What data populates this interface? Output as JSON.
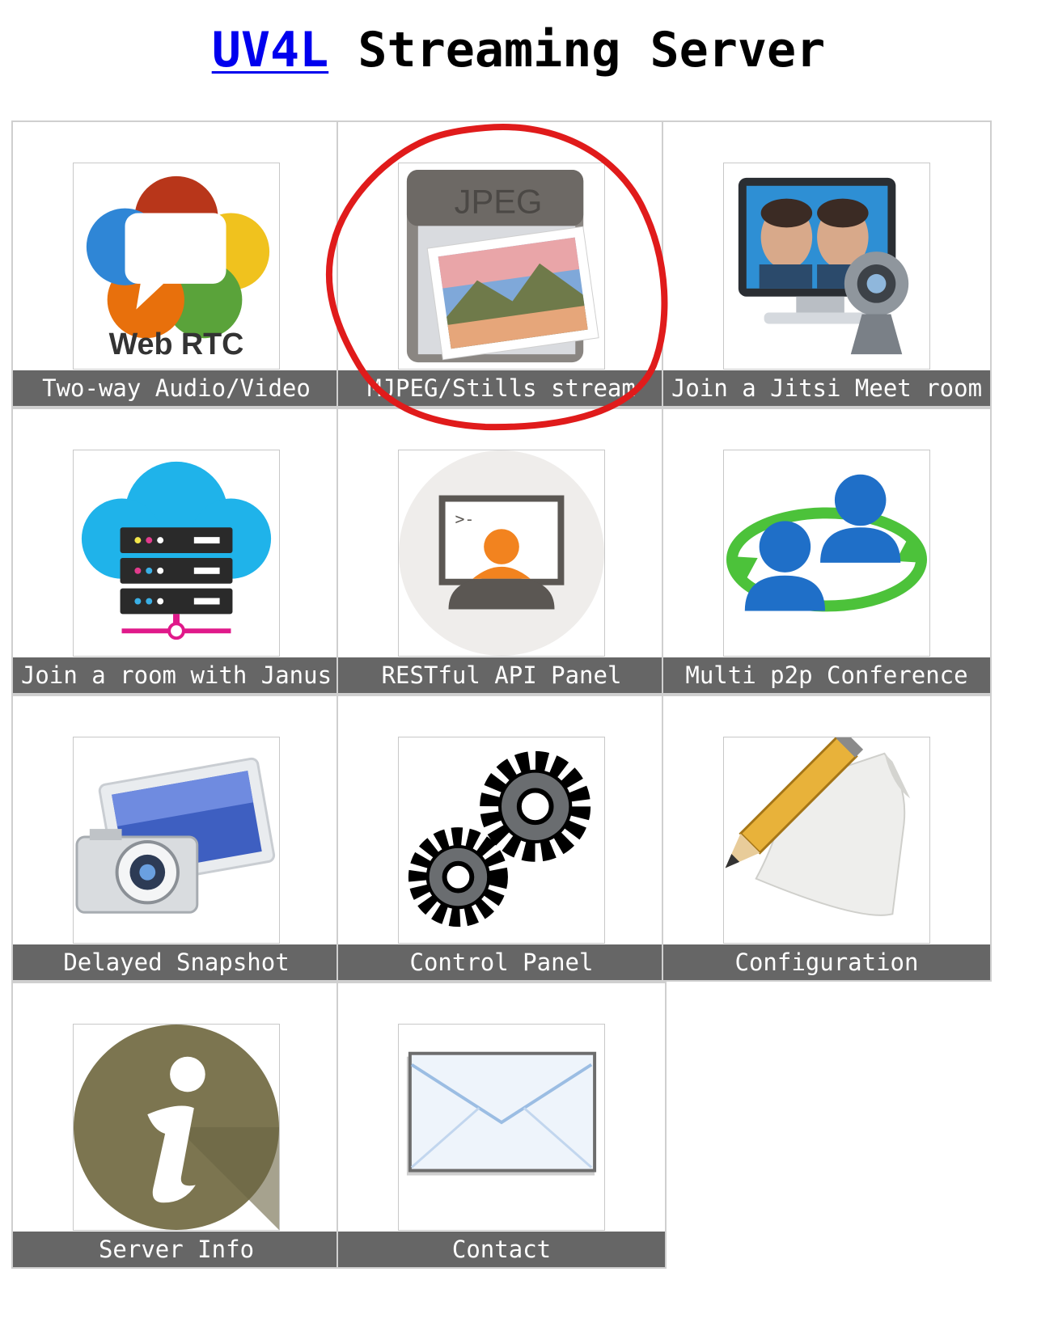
{
  "header": {
    "link_text": "UV4L",
    "title_rest": " Streaming Server"
  },
  "tiles": [
    {
      "label": "Two-way Audio/Video",
      "icon": "webrtc-logo"
    },
    {
      "label": "MJPEG/Stills stream",
      "icon": "jpeg-file-icon"
    },
    {
      "label": "Join a Jitsi Meet room",
      "icon": "videoconference-icon"
    },
    {
      "label": "Join a room with Janus",
      "icon": "cloud-server-icon"
    },
    {
      "label": "RESTful API Panel",
      "icon": "terminal-user-icon"
    },
    {
      "label": "Multi p2p Conference",
      "icon": "users-sync-icon"
    },
    {
      "label": "Delayed Snapshot",
      "icon": "camera-photo-icon"
    },
    {
      "label": "Control Panel",
      "icon": "gears-icon"
    },
    {
      "label": "Configuration",
      "icon": "pencil-paper-icon"
    },
    {
      "label": "Server Info",
      "icon": "info-icon"
    },
    {
      "label": "Contact",
      "icon": "envelope-icon"
    }
  ],
  "webrtc_logo_text": "Web RTC",
  "jpeg_badge_text": "JPEG",
  "colors": {
    "link": "#0000ee",
    "label_bg": "#666666",
    "annotation": "#e01b1b"
  }
}
